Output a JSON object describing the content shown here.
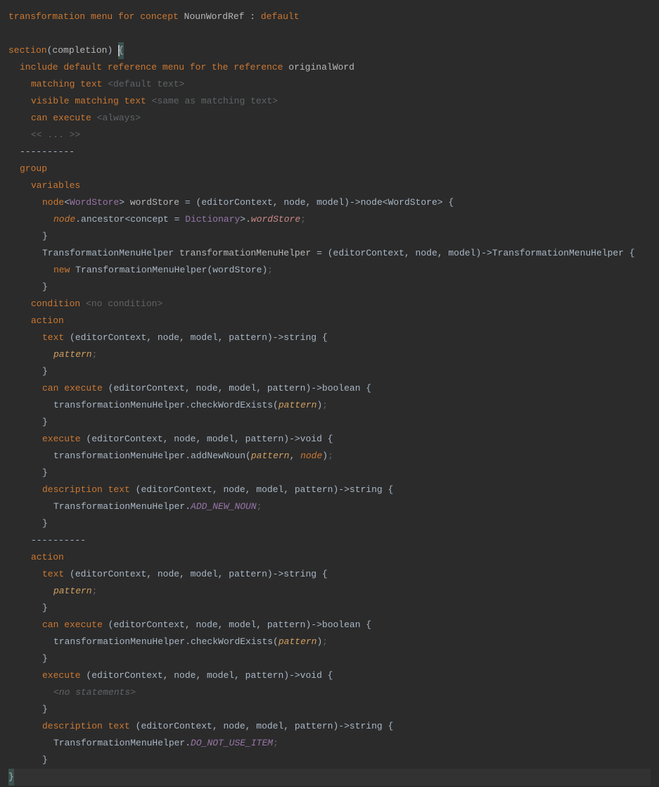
{
  "header": {
    "prefix": "transformation menu for concept",
    "concept": "NounWordRef",
    "suffix": "default"
  },
  "section": {
    "kw": "section",
    "arg": "completion"
  },
  "include": {
    "kw": "include default reference menu for the reference",
    "ref": "originalWord",
    "matching_kw": "matching text",
    "matching_ph": "<default text>",
    "visible_kw": "visible matching text",
    "visible_ph": "<same as matching text>",
    "can_kw": "can execute",
    "can_ph": "<always>",
    "more": "<< ... >>"
  },
  "sep": "----------",
  "group": {
    "kw": "group",
    "vars_kw": "variables",
    "var1_node": "node",
    "var1_type": "WordStore",
    "var1_name": "wordStore",
    "var1_lambda": "(editorContext, node, model)->node<WordStore> {",
    "var1_body_node": "node",
    "var1_body_dot": ".",
    "var1_body_anc": "ancestor<concept =",
    "var1_body_dict": "Dictionary",
    "var1_body_close": ">.",
    "var1_body_field": "wordStore",
    "var1_body_semi": ";",
    "var2_type": "TransformationMenuHelper",
    "var2_name": "transformationMenuHelper",
    "var2_lambda": "(editorContext, node, model)->TransformationMenuHelper {",
    "var2_new": "new",
    "var2_ctor": "TransformationMenuHelper(wordStore)",
    "var2_semi": ";",
    "cond_kw": "condition",
    "cond_ph": "<no condition>"
  },
  "brace_close": "}",
  "action1": {
    "kw": "action",
    "text_kw": "text",
    "text_sig": "(editorContext, node, model, pattern)->string {",
    "text_body": "pattern",
    "semi": ";",
    "can_kw": "can execute",
    "can_sig": "(editorContext, node, model, pattern)->boolean {",
    "can_body_pre": "transformationMenuHelper.checkWordExists(",
    "can_body_arg": "pattern",
    "can_body_post": ")",
    "exec_kw": "execute",
    "exec_sig": "(editorContext, node, model, pattern)->void {",
    "exec_body_pre": "transformationMenuHelper.addNewNoun(",
    "exec_body_arg1": "pattern",
    "exec_body_comma": ", ",
    "exec_body_arg2": "node",
    "exec_body_post": ")",
    "desc_kw": "description text",
    "desc_sig": "(editorContext, node, model, pattern)->string {",
    "desc_body_pre": "TransformationMenuHelper.",
    "desc_body_const": "ADD_NEW_NOUN"
  },
  "action2": {
    "kw": "action",
    "text_kw": "text",
    "text_sig": "(editorContext, node, model, pattern)->string {",
    "text_body": "pattern",
    "semi": ";",
    "can_kw": "can execute",
    "can_sig": "(editorContext, node, model, pattern)->boolean {",
    "can_body_pre": "transformationMenuHelper.checkWordExists(",
    "can_body_arg": "pattern",
    "can_body_post": ")",
    "exec_kw": "execute",
    "exec_sig": "(editorContext, node, model, pattern)->void {",
    "exec_body": "<no statements>",
    "desc_kw": "description text",
    "desc_sig": "(editorContext, node, model, pattern)->string {",
    "desc_body_pre": "TransformationMenuHelper.",
    "desc_body_const": "DO_NOT_USE_ITEM"
  }
}
